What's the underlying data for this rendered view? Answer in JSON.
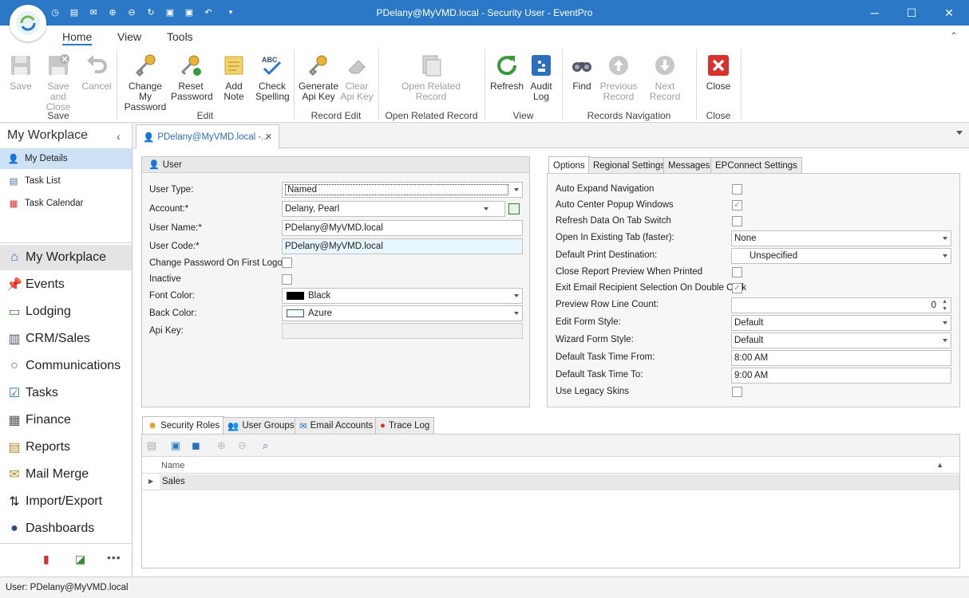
{
  "window": {
    "title": "PDelany@MyVMD.local - Security User - EventPro",
    "minimize": "─",
    "maximize": "☐",
    "close": "✕"
  },
  "ribbon_tabs": [
    "Home",
    "View",
    "Tools"
  ],
  "ribbon": {
    "save": "Save",
    "save_close_1": "Save and",
    "save_close_2": "Close",
    "cancel": "Cancel",
    "grp_save": "Save",
    "change_pw_1": "Change My",
    "change_pw_2": "Password",
    "reset_pw_1": "Reset",
    "reset_pw_2": "Password",
    "add_note": "Add Note",
    "check_spell_1": "Check",
    "check_spell_2": "Spelling",
    "grp_edit": "Edit",
    "gen_api_1": "Generate",
    "gen_api_2": "Api Key",
    "clear_api_1": "Clear",
    "clear_api_2": "Api Key",
    "grp_record_edit": "Record Edit",
    "open_related_1": "Open Related",
    "open_related_2": "Record",
    "grp_open_related": "Open Related Record",
    "refresh": "Refresh",
    "audit_1": "Audit",
    "audit_2": "Log",
    "grp_view": "View",
    "find": "Find",
    "prev_1": "Previous",
    "prev_2": "Record",
    "next": "Next Record",
    "grp_nav": "Records Navigation",
    "close": "Close",
    "grp_close": "Close"
  },
  "nav": {
    "header": "My Workplace",
    "items": [
      "My Details",
      "Task List",
      "Task Calendar"
    ],
    "big": [
      "My Workplace",
      "Events",
      "Lodging",
      "CRM/Sales",
      "Communications",
      "Tasks",
      "Finance",
      "Reports",
      "Mail Merge",
      "Import/Export",
      "Dashboards"
    ]
  },
  "doc_tab": "PDelany@MyVMD.local -...",
  "user_panel": {
    "title": "User",
    "user_type_lbl": "User Type:",
    "user_type": "Named",
    "account_lbl": "Account:*",
    "account": "Delany, Pearl",
    "username_lbl": "User Name:*",
    "username": "PDelany@MyVMD.local",
    "usercode_lbl": "User Code:*",
    "usercode": "PDelany@MyVMD.local",
    "change_pw_lbl": "Change Password On First Logon",
    "inactive_lbl": "Inactive",
    "font_color_lbl": "Font Color:",
    "font_color": "Black",
    "back_color_lbl": "Back Color:",
    "back_color": "Azure",
    "api_key_lbl": "Api Key:"
  },
  "options_tabs": [
    "Options",
    "Regional Settings",
    "Messages",
    "EPConnect Settings"
  ],
  "options": {
    "auto_expand": "Auto Expand Navigation",
    "auto_center": "Auto Center Popup Windows",
    "refresh_tab": "Refresh Data On Tab Switch",
    "open_existing": "Open In Existing Tab (faster):",
    "open_existing_val": "None",
    "print_dest": "Default Print Destination:",
    "print_dest_val": "Unspecified",
    "close_preview": "Close Report Preview When Printed",
    "exit_email": "Exit Email Recipient Selection On Double Click",
    "preview_rows": "Preview Row Line Count:",
    "preview_rows_val": "0",
    "edit_form": "Edit Form Style:",
    "edit_form_val": "Default",
    "wizard_form": "Wizard Form Style:",
    "wizard_form_val": "Default",
    "task_from": "Default Task Time From:",
    "task_from_val": "8:00 AM",
    "task_to": "Default Task Time To:",
    "task_to_val": "9:00 AM",
    "legacy": "Use Legacy Skins"
  },
  "bottom_tabs": [
    "Security Roles",
    "User Groups",
    "Email Accounts",
    "Trace Log"
  ],
  "grid": {
    "col_name": "Name",
    "rows": [
      "Sales"
    ]
  },
  "status": "User: PDelany@MyVMD.local",
  "colors": {
    "titlebar": "#2b79c6",
    "accent": "#2b6fbd",
    "close_red": "#d9312b"
  }
}
